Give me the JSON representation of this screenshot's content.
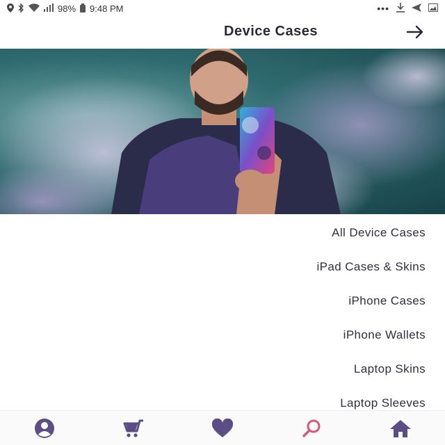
{
  "status_bar": {
    "time": "9:48 PM",
    "battery": "98%",
    "icons": [
      "location-icon",
      "bluetooth-icon",
      "wifi-icon",
      "signal-icon",
      "battery-icon",
      "more-icon",
      "download-icon",
      "send-icon",
      "image-icon"
    ]
  },
  "header": {
    "title": "Device Cases",
    "back_icon": "arrow-back-icon"
  },
  "hero": {
    "image": "man-holding-phone-case-smoke-background"
  },
  "categories": [
    "All Device Cases",
    "iPad Cases & Skins",
    "iPhone Cases",
    "iPhone Wallets",
    "Laptop Skins",
    "Laptop Sleeves"
  ],
  "bottom_nav": {
    "items": [
      "account-icon",
      "cart-icon",
      "heart-icon",
      "search-icon",
      "home-icon"
    ],
    "active": "search-icon"
  },
  "colors": {
    "nav_icon": "#5b4d86",
    "active_icon": "#d9587a",
    "text": "#2f2f40"
  }
}
